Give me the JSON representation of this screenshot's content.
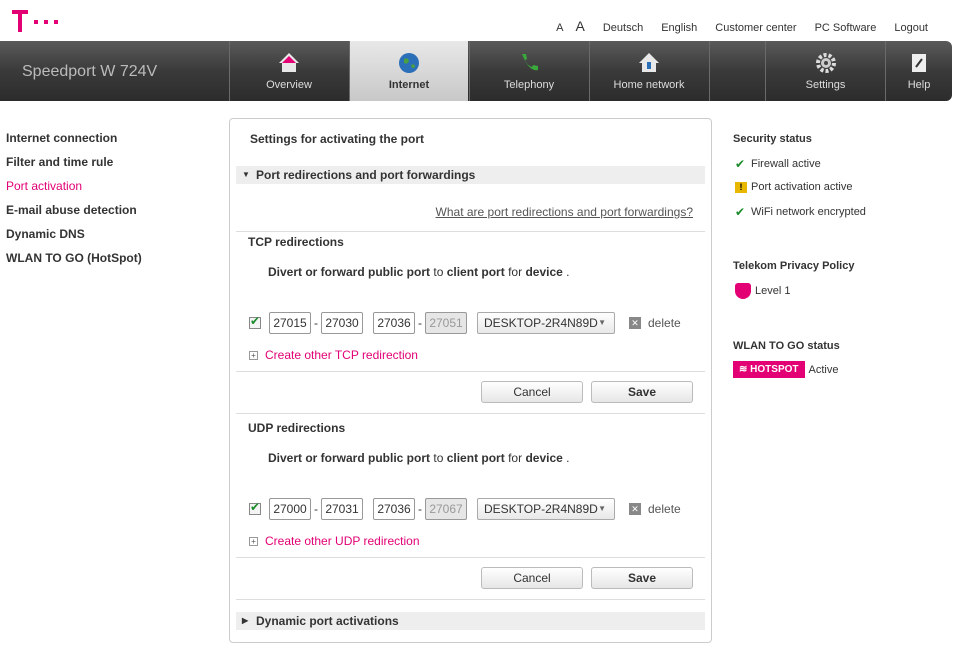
{
  "header": {
    "brand": "Speedport W 724V",
    "top_links": [
      "A",
      "A",
      "Deutsch",
      "English",
      "Customer center",
      "PC Software",
      "Logout"
    ]
  },
  "nav": [
    {
      "label": "Overview",
      "icon": "house-icon"
    },
    {
      "label": "Internet",
      "icon": "globe-icon",
      "active": true
    },
    {
      "label": "Telephony",
      "icon": "phone-icon"
    },
    {
      "label": "Home network",
      "icon": "network-house-icon"
    },
    {
      "label": "Settings",
      "icon": "gear-icon"
    },
    {
      "label": "Help",
      "icon": "help-book-icon"
    }
  ],
  "sidebar": {
    "items": [
      "Internet connection",
      "Filter and time rule",
      "Port activation",
      "E-mail abuse detection",
      "Dynamic DNS",
      "WLAN TO GO (HotSpot)"
    ],
    "active": "Port activation"
  },
  "main": {
    "title": "Settings for activating the port",
    "section1": "Port redirections and port forwardings",
    "help_link": "What are port redirections and port forwardings?",
    "tcp": {
      "heading": "TCP redirections",
      "desc_a": "Divert or forward public port",
      "desc_b": "to",
      "desc_c": "client port",
      "desc_d": "for",
      "desc_e": "device",
      "desc_f": ".",
      "checked": true,
      "pub_from": "27015",
      "pub_to": "27030",
      "cli_from": "27036",
      "cli_to": "27051",
      "device": "DESKTOP-2R4N89D",
      "delete": "delete",
      "add": "Create other TCP redirection",
      "cancel": "Cancel",
      "save": "Save"
    },
    "udp": {
      "heading": "UDP redirections",
      "desc_a": "Divert or forward public port",
      "desc_b": "to",
      "desc_c": "client port",
      "desc_d": "for",
      "desc_e": "device",
      "desc_f": ".",
      "checked": true,
      "pub_from": "27000",
      "pub_to": "27031",
      "cli_from": "27036",
      "cli_to": "27067",
      "device": "DESKTOP-2R4N89D",
      "delete": "delete",
      "add": "Create other UDP redirection",
      "cancel": "Cancel",
      "save": "Save"
    },
    "section2": "Dynamic port activations"
  },
  "status": {
    "security_title": "Security status",
    "items": [
      {
        "icon": "check-icon",
        "text": "Firewall active"
      },
      {
        "icon": "warning-icon",
        "text": "Port activation active"
      },
      {
        "icon": "check-icon",
        "text": "WiFi network encrypted"
      }
    ],
    "privacy_title": "Telekom Privacy Policy",
    "privacy_level": "Level 1",
    "wlan_title": "WLAN TO GO status",
    "hotspot_badge": "HOTSPOT",
    "hotspot_state": "Active"
  },
  "colors": {
    "accent": "#e20074",
    "check": "#1a8a2a",
    "navbar": "#3a3a3a"
  }
}
